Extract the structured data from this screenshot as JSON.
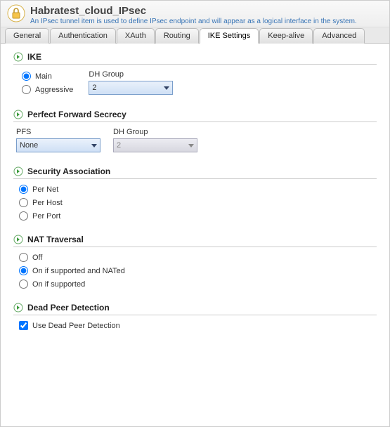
{
  "header": {
    "title": "Habratest_cloud_IPsec",
    "subtitle": "An IPsec tunnel item is used to define IPsec endpoint and will appear as a logical interface in the system."
  },
  "tabs": [
    "General",
    "Authentication",
    "XAuth",
    "Routing",
    "IKE Settings",
    "Keep-alive",
    "Advanced"
  ],
  "active_tab": "IKE Settings",
  "ike": {
    "title": "IKE",
    "mode_options": [
      "Main",
      "Aggressive"
    ],
    "mode_selected": "Main",
    "dh_label": "DH Group",
    "dh_value": "2"
  },
  "pfs": {
    "title": "Perfect Forward Secrecy",
    "pfs_label": "PFS",
    "pfs_value": "None",
    "dh_label": "DH Group",
    "dh_value": "2"
  },
  "sa": {
    "title": "Security Association",
    "options": [
      "Per Net",
      "Per Host",
      "Per Port"
    ],
    "selected": "Per Net"
  },
  "nat": {
    "title": "NAT Traversal",
    "options": [
      "Off",
      "On if supported and NATed",
      "On if supported"
    ],
    "selected": "On if supported and NATed"
  },
  "dpd": {
    "title": "Dead Peer Detection",
    "checkbox_label": "Use Dead Peer Detection",
    "checked": true
  }
}
